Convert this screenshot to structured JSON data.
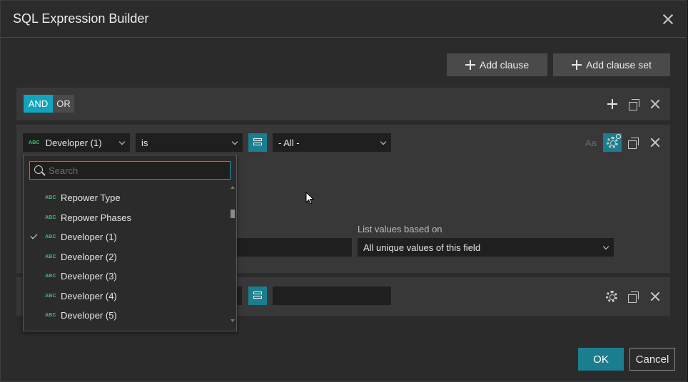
{
  "dialog": {
    "title": "SQL Expression Builder",
    "close_icon": "close-icon"
  },
  "toolbar": {
    "add_clause_label": "Add clause",
    "add_clause_set_label": "Add clause set"
  },
  "clause_set": {
    "and_label": "AND",
    "or_label": "OR",
    "active_logic": "AND"
  },
  "clause1": {
    "field_value": "Developer (1)",
    "field_type": "ABC",
    "operator_value": "is",
    "value_select": "- All -",
    "case_label": "Aa"
  },
  "clause1_settings": {
    "list_values_label": "List values based on",
    "list_values_value": "All unique values of this field"
  },
  "dropdown": {
    "search_placeholder": "Search",
    "items": [
      {
        "type": "ABC",
        "label": "Repower Type",
        "checked": false
      },
      {
        "type": "ABC",
        "label": "Repower Phases",
        "checked": false
      },
      {
        "type": "ABC",
        "label": "Developer (1)",
        "checked": true
      },
      {
        "type": "ABC",
        "label": "Developer (2)",
        "checked": false
      },
      {
        "type": "ABC",
        "label": "Developer (3)",
        "checked": false
      },
      {
        "type": "ABC",
        "label": "Developer (4)",
        "checked": false
      },
      {
        "type": "ABC",
        "label": "Developer (5)",
        "checked": false
      }
    ]
  },
  "footer": {
    "ok_label": "OK",
    "cancel_label": "Cancel"
  },
  "colors": {
    "accent": "#1b7e8f",
    "and_active": "#12a4bd",
    "field_type_green": "#35c46a",
    "background": "#2b2b2b"
  }
}
